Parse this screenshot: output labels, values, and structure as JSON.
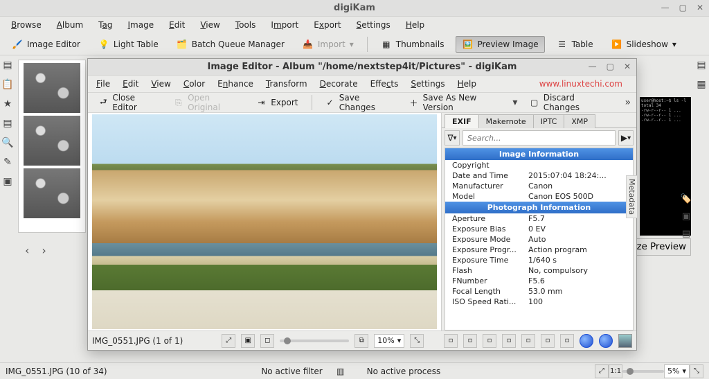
{
  "main": {
    "title": "digiKam",
    "menu": [
      "Browse",
      "Album",
      "Tag",
      "Image",
      "Edit",
      "View",
      "Tools",
      "Import",
      "Export",
      "Settings",
      "Help"
    ],
    "toolbar": {
      "image_editor": "Image Editor",
      "light_table": "Light Table",
      "bqm": "Batch Queue Manager",
      "import": "Import",
      "thumbnails": "Thumbnails",
      "preview_image": "Preview Image",
      "table": "Table",
      "slideshow": "Slideshow"
    },
    "size_preview_btn": "ze Preview",
    "status": {
      "file": "IMG_0551.JPG (10 of 34)",
      "no_filter": "No active filter",
      "no_process": "No active process",
      "zoom": "5%"
    }
  },
  "editor": {
    "title": "Image Editor - Album \"/home/nextstep4it/Pictures\" - digiKam",
    "url": "www.linuxtechi.com",
    "menu": [
      "File",
      "Edit",
      "View",
      "Color",
      "Enhance",
      "Transform",
      "Decorate",
      "Effects",
      "Settings",
      "Help"
    ],
    "toolbar": {
      "close": "Close Editor",
      "open_original": "Open Original",
      "export": "Export",
      "save_changes": "Save Changes",
      "save_as_new": "Save As New Version",
      "discard": "Discard Changes"
    },
    "tabs": [
      "EXIF",
      "Makernote",
      "IPTC",
      "XMP"
    ],
    "active_tab": 0,
    "search_placeholder": "Search...",
    "vertical_label": "Metadata",
    "metadata": {
      "sec1": "Image Information",
      "sec2": "Photograph Information",
      "rows1": [
        {
          "k": "Copyright",
          "v": ""
        },
        {
          "k": "Date and Time",
          "v": "2015:07:04 18:24:..."
        },
        {
          "k": "Manufacturer",
          "v": "Canon"
        },
        {
          "k": "Model",
          "v": "Canon EOS 500D"
        }
      ],
      "rows2": [
        {
          "k": "Aperture",
          "v": "F5.7"
        },
        {
          "k": "Exposure Bias",
          "v": "0 EV"
        },
        {
          "k": "Exposure Mode",
          "v": "Auto"
        },
        {
          "k": "Exposure Progr...",
          "v": "Action program"
        },
        {
          "k": "Exposure Time",
          "v": "1/640 s"
        },
        {
          "k": "Flash",
          "v": "No, compulsory"
        },
        {
          "k": "FNumber",
          "v": "F5.6"
        },
        {
          "k": "Focal Length",
          "v": "53.0 mm"
        },
        {
          "k": "ISO Speed Rati...",
          "v": "100"
        }
      ]
    },
    "footer": {
      "file": "IMG_0551.JPG (1 of 1)",
      "zoom": "10%"
    }
  }
}
